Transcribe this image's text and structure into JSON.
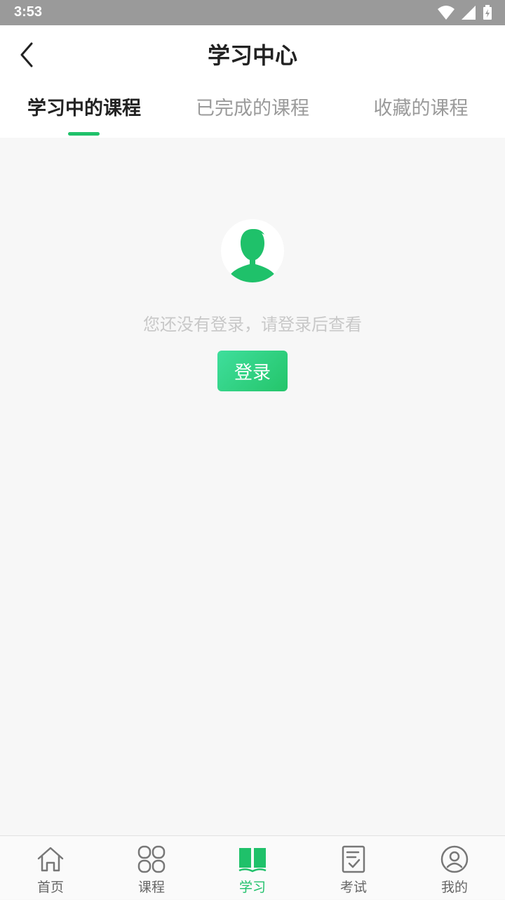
{
  "status_bar": {
    "time": "3:53"
  },
  "header": {
    "title": "学习中心"
  },
  "tabs": [
    {
      "label": "学习中的课程",
      "active": true
    },
    {
      "label": "已完成的课程",
      "active": false
    },
    {
      "label": "收藏的课程",
      "active": false
    }
  ],
  "empty_state": {
    "message": "您还没有登录，请登录后查看",
    "login_label": "登录"
  },
  "bottom_nav": [
    {
      "label": "首页",
      "icon": "home-icon",
      "active": false
    },
    {
      "label": "课程",
      "icon": "grid-icon",
      "active": false
    },
    {
      "label": "学习",
      "icon": "book-icon",
      "active": true
    },
    {
      "label": "考试",
      "icon": "exam-icon",
      "active": false
    },
    {
      "label": "我的",
      "icon": "profile-icon",
      "active": false
    }
  ],
  "colors": {
    "accent": "#1fc16a",
    "status_bar": "#9a9a9a",
    "background": "#f7f7f7"
  }
}
